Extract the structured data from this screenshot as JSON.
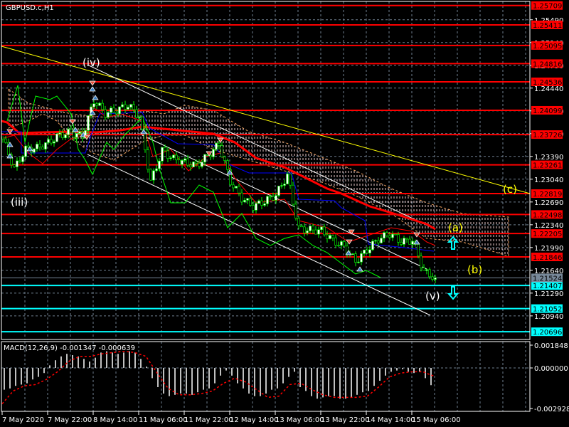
{
  "window": {
    "symbol_title": "GBPUSD.c,H1"
  },
  "colors": {
    "background": "#000000",
    "level_red": "#ff0000",
    "level_cyan": "#00ffff",
    "current_gray": "#778899",
    "trend_yellow": "#ffff00",
    "bull_body": "#ffffff",
    "candle_outline": "#00ff00",
    "ma": "#ff0000",
    "kijun": "#0000ff",
    "chikou": "#00ff00",
    "macd_hist": "#c0c0c0",
    "macd_signal": "#ff0000"
  },
  "chart_data": [
    {
      "type": "candlestick",
      "title": "GBPUSD.c,H1",
      "ylim": [
        1.20578,
        1.25793
      ],
      "y_ticks": [
        "1.25490",
        "1.25140",
        "1.24790",
        "1.24440",
        "1.24090",
        "1.23740",
        "1.23390",
        "1.23040",
        "1.22690",
        "1.22340",
        "1.21990",
        "1.21640",
        "1.21290",
        "1.20940"
      ],
      "x_ticks": [
        "7 May 2020",
        "7 May 22:00",
        "8 May 14:00",
        "11 May 06:00",
        "11 May 22:00",
        "12 May 14:00",
        "13 May 06:00",
        "13 May 22:00",
        "14 May 14:00",
        "15 May 06:00"
      ],
      "close_path": [
        1.2366,
        1.232,
        1.235,
        1.2352,
        1.236,
        1.2372,
        1.2376,
        1.237,
        1.2425,
        1.2405,
        1.241,
        1.2418,
        1.24,
        1.23,
        1.2348,
        1.2335,
        1.233,
        1.2325,
        1.234,
        1.2358,
        1.23,
        1.2275,
        1.2262,
        1.227,
        1.228,
        1.231,
        1.2228,
        1.2226,
        1.2225,
        1.221,
        1.22,
        1.2178,
        1.2195,
        1.2212,
        1.222,
        1.2208,
        1.221,
        1.2162,
        1.21524
      ],
      "current_price": "1.21524",
      "red_levels": [
        "1.25709",
        "1.25411",
        "1.25095",
        "1.24816",
        "1.24536",
        "1.24099",
        "1.23726",
        "1.23261",
        "1.22819",
        "1.22498",
        "1.22205",
        "1.21846"
      ],
      "cyan_levels": [
        "1.21407",
        "1.21052",
        "1.20696"
      ],
      "wave_labels": [
        {
          "text": "(iii)",
          "color": "#ffffff"
        },
        {
          "text": "(iv)",
          "color": "#ffffff"
        },
        {
          "text": "(v)",
          "color": "#ffffff"
        },
        {
          "text": "(a)",
          "color": "#ffff00"
        },
        {
          "text": "(b)",
          "color": "#ffff00"
        },
        {
          "text": "(c)",
          "color": "#ffff00"
        }
      ]
    },
    {
      "type": "bar",
      "title": "MACD(12,26,9) -0.001347 -0.000639",
      "indicator": "MACD(12,26,9)",
      "macd_value": "-0.001347",
      "signal_value": "-0.000639",
      "ylim": [
        -0.002928,
        0.001848
      ],
      "y_ticks": [
        "0.001848",
        "0.000000",
        "-0.002928"
      ],
      "histogram_e4": [
        -17,
        -16,
        -14,
        -13,
        -12,
        -9,
        -7,
        -4,
        2,
        6,
        9,
        11,
        10,
        9,
        7,
        5,
        8,
        12,
        13,
        12,
        11,
        12,
        13,
        12,
        7,
        1,
        -8,
        -15,
        -20,
        -22,
        -21,
        -20,
        -20,
        -21,
        -19,
        -17,
        -16,
        -12,
        -6,
        -2,
        -6,
        -12,
        -16,
        -20,
        -22,
        -22,
        -20,
        -17,
        -16,
        -12,
        -7,
        -3,
        -15,
        -18,
        -22,
        -24,
        -23,
        -22,
        -22,
        -24,
        -24,
        -23,
        -21,
        -19,
        -18,
        -14,
        -10,
        -6,
        -3,
        -2,
        -1,
        -3,
        -4,
        -3,
        -8,
        -13.47
      ],
      "signal_e4": [
        -28,
        -18,
        -14,
        -13,
        -9,
        -3,
        5,
        9,
        9,
        11,
        12,
        13,
        12,
        9,
        -4,
        -16,
        -21,
        -21,
        -20,
        -18,
        -12,
        -8,
        -11,
        -17,
        -23,
        -22,
        -13,
        -12,
        -17,
        -21,
        -23,
        -23,
        -23,
        -22,
        -15,
        -7,
        -4,
        -3,
        -3,
        -6.39
      ]
    }
  ]
}
